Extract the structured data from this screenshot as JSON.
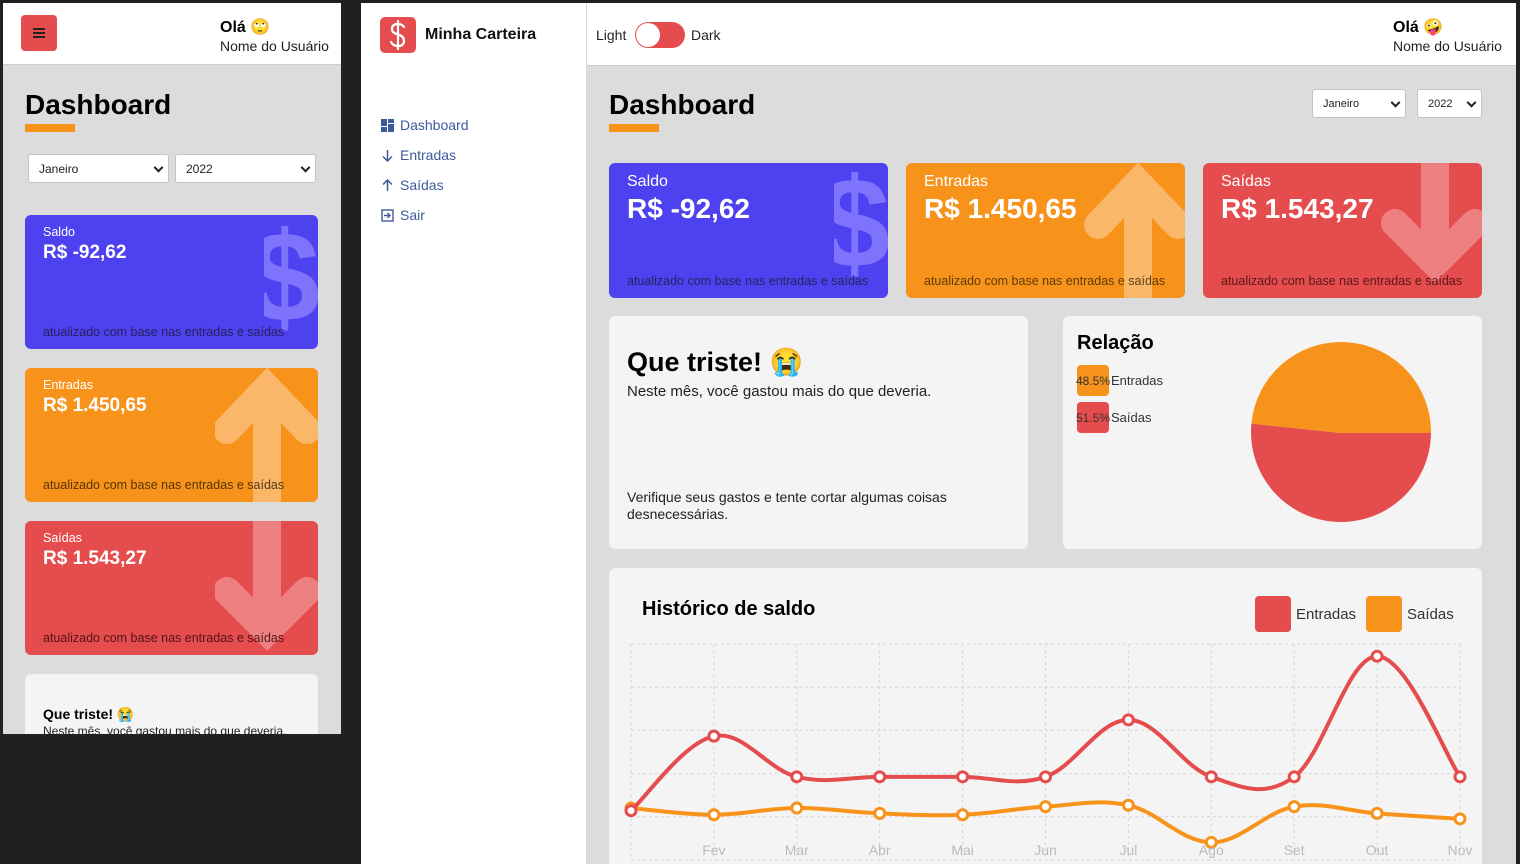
{
  "user": {
    "greeting": "Olá",
    "name": "Nome do Usuário"
  },
  "app": {
    "name": "Minha Carteira",
    "logo_symbol": "$"
  },
  "theme_toggle": {
    "left_label": "Light",
    "right_label": "Dark"
  },
  "sidebar": {
    "items": [
      {
        "label": "Dashboard",
        "icon": "dashboard-icon"
      },
      {
        "label": "Entradas",
        "icon": "arrow-down-icon"
      },
      {
        "label": "Saídas",
        "icon": "arrow-up-icon"
      },
      {
        "label": "Sair",
        "icon": "exit-icon"
      }
    ]
  },
  "dashboard": {
    "title": "Dashboard",
    "month_select": "Janeiro",
    "year_select": "2022"
  },
  "cards": {
    "saldo": {
      "title": "Saldo",
      "amount": "R$ -92,62",
      "footer": "atualizado com base nas entradas e saídas"
    },
    "entradas": {
      "title": "Entradas",
      "amount": "R$ 1.450,65",
      "footer": "atualizado com base nas entradas e saídas"
    },
    "saidas": {
      "title": "Saídas",
      "amount": "R$ 1.543,27",
      "footer": "atualizado com base nas entradas e saídas"
    }
  },
  "message": {
    "title": "Que triste!",
    "emoji": "😭",
    "description": "Neste mês, você gastou mais do que deveria.",
    "footer": "Verifique seus gastos e tente cortar algumas coisas desnecessárias."
  },
  "relacao": {
    "title": "Relação",
    "items": [
      {
        "percent": "48.5%",
        "label": "Entradas",
        "color": "#f7931b"
      },
      {
        "percent": "51.5%",
        "label": "Saídas",
        "color": "#e44c4e"
      }
    ]
  },
  "colors": {
    "blue": "#4e41f0",
    "orange": "#f7931b",
    "red": "#e44c4e"
  },
  "chart_data": {
    "type": "line",
    "title": "Histórico de saldo",
    "categories": [
      "Jan",
      "Fev",
      "Mar",
      "Abr",
      "Mai",
      "Jun",
      "Jul",
      "Ago",
      "Set",
      "Out",
      "Nov"
    ],
    "tick_labels_visible": [
      "Fev",
      "Mar",
      "Abr",
      "Mai",
      "Jun",
      "Jul",
      "Ago",
      "Set",
      "Out",
      "Nov"
    ],
    "legend": [
      {
        "name": "Entradas",
        "color": "#e44c4e"
      },
      {
        "name": "Saídas",
        "color": "#f7931b"
      }
    ],
    "series": [
      {
        "name": "Entradas",
        "color": "#e44c4e",
        "values": [
          1450,
          4200,
          2700,
          2700,
          2700,
          2700,
          4800,
          2700,
          2700,
          7150,
          2700
        ]
      },
      {
        "name": "Saídas",
        "color": "#f7931b",
        "values": [
          1550,
          1300,
          1550,
          1350,
          1300,
          1600,
          1650,
          280,
          1600,
          1350,
          1150
        ]
      }
    ],
    "grid": true
  }
}
